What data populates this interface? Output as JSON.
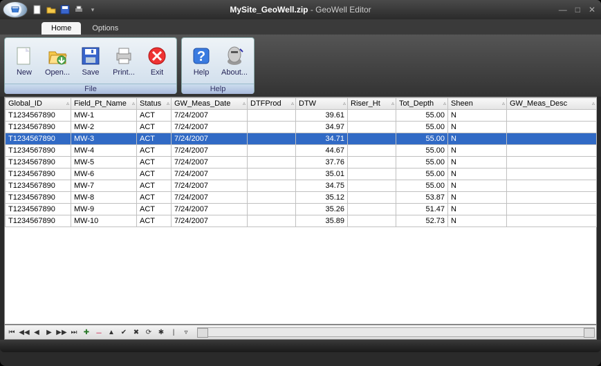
{
  "title": {
    "file": "MySite_GeoWell.zip",
    "app": "GeoWell Editor"
  },
  "tabs": [
    {
      "label": "Home",
      "active": true
    },
    {
      "label": "Options",
      "active": false
    }
  ],
  "ribbon": {
    "groups": [
      {
        "label": "File",
        "items": [
          {
            "key": "new",
            "label": "New"
          },
          {
            "key": "open",
            "label": "Open..."
          },
          {
            "key": "save",
            "label": "Save"
          },
          {
            "key": "print",
            "label": "Print..."
          },
          {
            "key": "exit",
            "label": "Exit"
          }
        ]
      },
      {
        "label": "Help",
        "items": [
          {
            "key": "help",
            "label": "Help"
          },
          {
            "key": "about",
            "label": "About..."
          }
        ]
      }
    ]
  },
  "columns": [
    "Global_ID",
    "Field_Pt_Name",
    "Status",
    "GW_Meas_Date",
    "DTFProd",
    "DTW",
    "Riser_Ht",
    "Tot_Depth",
    "Sheen",
    "GW_Meas_Desc"
  ],
  "rows": [
    {
      "Global_ID": "T1234567890",
      "Field_Pt_Name": "MW-1",
      "Status": "ACT",
      "GW_Meas_Date": "7/24/2007",
      "DTFProd": "",
      "DTW": "39.61",
      "Riser_Ht": "",
      "Tot_Depth": "55.00",
      "Sheen": "N",
      "GW_Meas_Desc": ""
    },
    {
      "Global_ID": "T1234567890",
      "Field_Pt_Name": "MW-2",
      "Status": "ACT",
      "GW_Meas_Date": "7/24/2007",
      "DTFProd": "",
      "DTW": "34.97",
      "Riser_Ht": "",
      "Tot_Depth": "55.00",
      "Sheen": "N",
      "GW_Meas_Desc": ""
    },
    {
      "Global_ID": "T1234567890",
      "Field_Pt_Name": "MW-3",
      "Status": "ACT",
      "GW_Meas_Date": "7/24/2007",
      "DTFProd": "",
      "DTW": "34.71",
      "Riser_Ht": "",
      "Tot_Depth": "55.00",
      "Sheen": "N",
      "GW_Meas_Desc": "",
      "selected": true
    },
    {
      "Global_ID": "T1234567890",
      "Field_Pt_Name": "MW-4",
      "Status": "ACT",
      "GW_Meas_Date": "7/24/2007",
      "DTFProd": "",
      "DTW": "44.67",
      "Riser_Ht": "",
      "Tot_Depth": "55.00",
      "Sheen": "N",
      "GW_Meas_Desc": ""
    },
    {
      "Global_ID": "T1234567890",
      "Field_Pt_Name": "MW-5",
      "Status": "ACT",
      "GW_Meas_Date": "7/24/2007",
      "DTFProd": "",
      "DTW": "37.76",
      "Riser_Ht": "",
      "Tot_Depth": "55.00",
      "Sheen": "N",
      "GW_Meas_Desc": ""
    },
    {
      "Global_ID": "T1234567890",
      "Field_Pt_Name": "MW-6",
      "Status": "ACT",
      "GW_Meas_Date": "7/24/2007",
      "DTFProd": "",
      "DTW": "35.01",
      "Riser_Ht": "",
      "Tot_Depth": "55.00",
      "Sheen": "N",
      "GW_Meas_Desc": ""
    },
    {
      "Global_ID": "T1234567890",
      "Field_Pt_Name": "MW-7",
      "Status": "ACT",
      "GW_Meas_Date": "7/24/2007",
      "DTFProd": "",
      "DTW": "34.75",
      "Riser_Ht": "",
      "Tot_Depth": "55.00",
      "Sheen": "N",
      "GW_Meas_Desc": ""
    },
    {
      "Global_ID": "T1234567890",
      "Field_Pt_Name": "MW-8",
      "Status": "ACT",
      "GW_Meas_Date": "7/24/2007",
      "DTFProd": "",
      "DTW": "35.12",
      "Riser_Ht": "",
      "Tot_Depth": "53.87",
      "Sheen": "N",
      "GW_Meas_Desc": ""
    },
    {
      "Global_ID": "T1234567890",
      "Field_Pt_Name": "MW-9",
      "Status": "ACT",
      "GW_Meas_Date": "7/24/2007",
      "DTFProd": "",
      "DTW": "35.26",
      "Riser_Ht": "",
      "Tot_Depth": "51.47",
      "Sheen": "N",
      "GW_Meas_Desc": ""
    },
    {
      "Global_ID": "T1234567890",
      "Field_Pt_Name": "MW-10",
      "Status": "ACT",
      "GW_Meas_Date": "7/24/2007",
      "DTFProd": "",
      "DTW": "35.89",
      "Riser_Ht": "",
      "Tot_Depth": "52.73",
      "Sheen": "N",
      "GW_Meas_Desc": ""
    }
  ],
  "numeric_cols": [
    "DTW",
    "Tot_Depth"
  ],
  "nav_icons": [
    "first",
    "prev-page",
    "prev",
    "next",
    "next-page",
    "last",
    "add",
    "remove",
    "edit",
    "accept",
    "cancel",
    "refresh",
    "bookmark",
    "sep",
    "filter"
  ]
}
